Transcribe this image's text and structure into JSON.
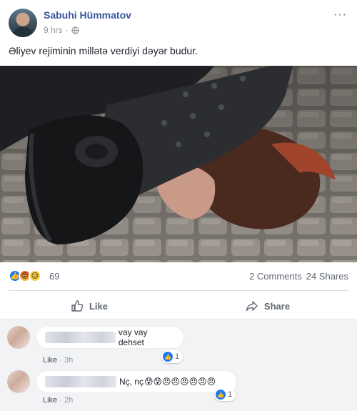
{
  "post": {
    "author": "Sabuhi Hümmatov",
    "time": "9 hrs",
    "more_glyph": "···",
    "text": "Əliyev rejiminin millətə verdiyi dəyər budur.",
    "photo_icon": "photo"
  },
  "reactions": {
    "icons": [
      "like-icon",
      "angry-icon",
      "sad-icon"
    ],
    "count": "69",
    "comments_label": "2 Comments",
    "shares_label": "24 Shares"
  },
  "actions": {
    "like_label": "Like",
    "share_label": "Share"
  },
  "comments": [
    {
      "text": "vay vay dehset",
      "like_label": "Like",
      "time": "3h",
      "reaction_count": "1"
    },
    {
      "text": "Nç, nç",
      "emojis": "😰😰😠😠😠😠😠😠",
      "like_label": "Like",
      "time": "2h",
      "reaction_count": "1"
    }
  ],
  "colors": {
    "author_link": "#385898",
    "facebook_blue": "#2078f4",
    "meta_gray": "#90949c",
    "comments_bg": "#f2f3f5"
  }
}
